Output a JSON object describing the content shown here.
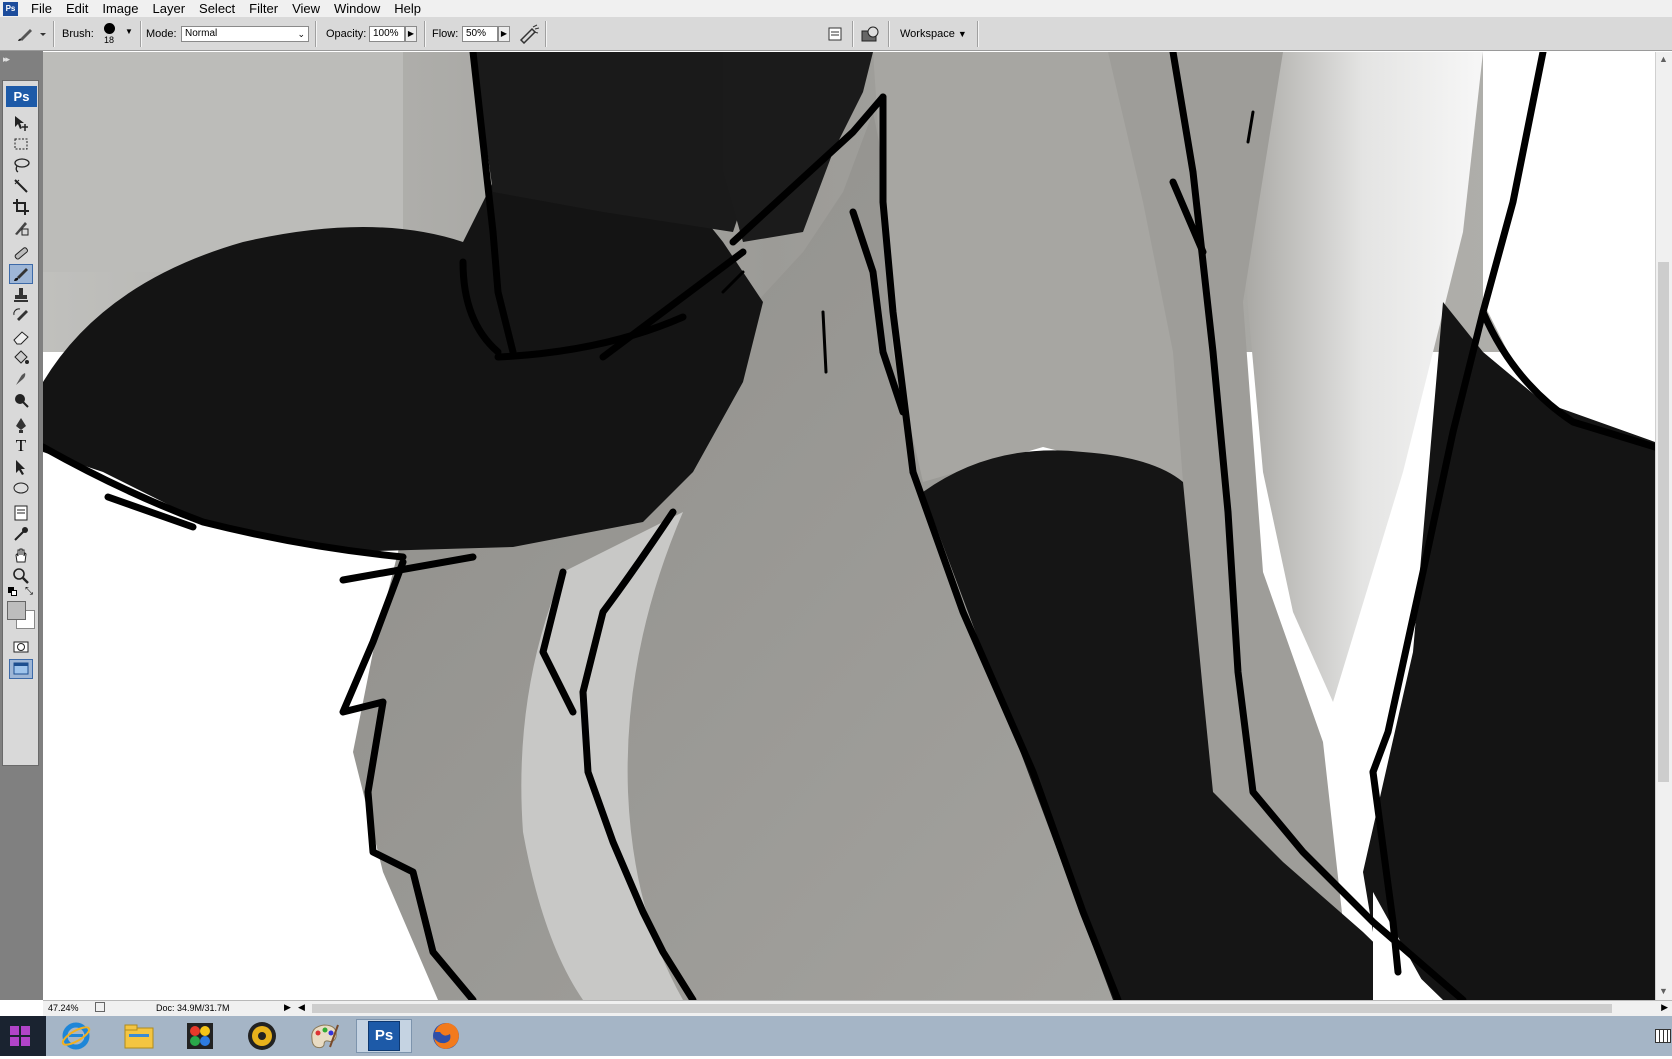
{
  "menubar": {
    "items": [
      "File",
      "Edit",
      "Image",
      "Layer",
      "Select",
      "Filter",
      "View",
      "Window",
      "Help"
    ]
  },
  "options": {
    "brush_label": "Brush:",
    "brush_size": "18",
    "mode_label": "Mode:",
    "mode_value": "Normal",
    "opacity_label": "Opacity:",
    "opacity_value": "100%",
    "flow_label": "Flow:",
    "flow_value": "50%",
    "workspace_label": "Workspace"
  },
  "toolbox": {
    "badge": "Ps",
    "tools": [
      "move-tool",
      "marquee-tool",
      "lasso-tool",
      "magic-wand-tool",
      "crop-tool",
      "slice-tool",
      "healing-brush-tool",
      "brush-tool",
      "clone-stamp-tool",
      "history-brush-tool",
      "eraser-tool",
      "paint-bucket-tool",
      "blur-tool",
      "dodge-tool",
      "pen-tool",
      "type-tool",
      "path-selection-tool",
      "shape-tool",
      "notes-tool",
      "eyedropper-tool",
      "hand-tool",
      "zoom-tool"
    ],
    "type_glyph": "T",
    "active_tool": "brush-tool"
  },
  "status": {
    "zoom": "47.24%",
    "doc": "Doc: 34.9M/31.7M"
  },
  "taskbar": {
    "apps": [
      "internet-explorer",
      "file-explorer",
      "paint-shop",
      "media-player",
      "paint",
      "photoshop",
      "firefox"
    ],
    "active_app": "photoshop",
    "ps_label": "Ps"
  },
  "colors": {
    "accent": "#1d5aa8",
    "fur_black": "#141414",
    "fur_grey": "#9a9994",
    "fur_light": "#c9c9c7",
    "background_grey": "#a8a8a4"
  }
}
